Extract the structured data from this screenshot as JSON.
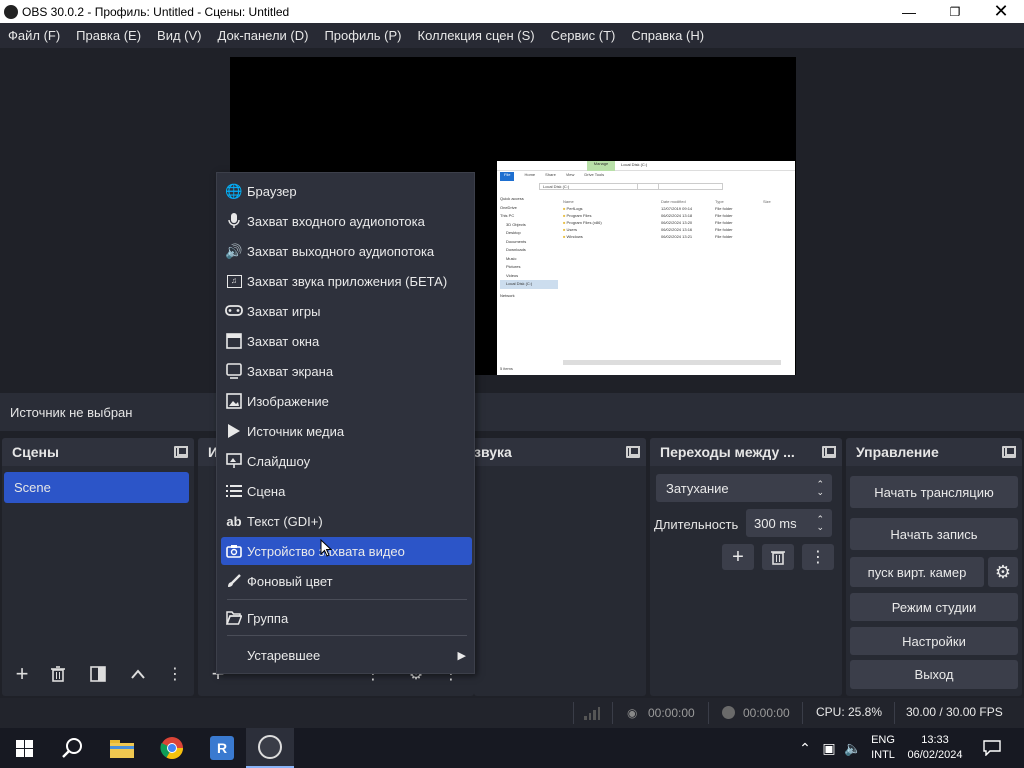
{
  "window": {
    "title": "OBS 30.0.2 - Профиль: Untitled - Сцены: Untitled",
    "controls": {
      "minimize": "minimize-icon",
      "maximize": "restore-icon",
      "close": "close-icon"
    }
  },
  "menu": [
    "Файл (F)",
    "Правка (E)",
    "Вид (V)",
    "Док-панели (D)",
    "Профиль (P)",
    "Коллекция сцен (S)",
    "Сервис (T)",
    "Справка (H)"
  ],
  "source_bar": {
    "no_source": "Источник не выбран"
  },
  "scenes_dock": {
    "title": "Сцены",
    "items": [
      "Scene"
    ],
    "selected_color": "#2c55c8"
  },
  "sources_dock": {
    "title_fragment": "И"
  },
  "audio_dock": {
    "title_fragment": "звука"
  },
  "transitions_dock": {
    "title": "Переходы между ...",
    "transition": "Затухание",
    "duration_label": "Длительность",
    "duration_value": "300 ms"
  },
  "controls_dock": {
    "title": "Управление",
    "start_stream": "Начать трансляцию",
    "start_record": "Начать запись",
    "virtual_cam": "пуск вирт. камер",
    "studio_mode": "Режим студии",
    "settings": "Настройки",
    "exit": "Выход"
  },
  "context_menu": {
    "items": [
      {
        "label": "Браузер",
        "icon": "globe-icon"
      },
      {
        "label": "Захват входного аудиопотока",
        "icon": "microphone-icon"
      },
      {
        "label": "Захват выходного аудиопотока",
        "icon": "speaker-icon"
      },
      {
        "label": "Захват звука приложения (БЕТА)",
        "icon": "app-audio-icon"
      },
      {
        "label": "Захват игры",
        "icon": "gamepad-icon"
      },
      {
        "label": "Захват окна",
        "icon": "window-icon"
      },
      {
        "label": "Захват экрана",
        "icon": "monitor-icon"
      },
      {
        "label": "Изображение",
        "icon": "image-icon"
      },
      {
        "label": "Источник медиа",
        "icon": "play-icon"
      },
      {
        "label": "Слайдшоу",
        "icon": "slideshow-icon"
      },
      {
        "label": "Сцена",
        "icon": "list-icon"
      },
      {
        "label": "Текст (GDI+)",
        "icon": "text-icon"
      },
      {
        "label": "Устройство захвата видео",
        "icon": "camera-icon",
        "selected": true
      },
      {
        "label": "Фоновый цвет",
        "icon": "brush-icon"
      }
    ],
    "group": {
      "label": "Группа",
      "icon": "folder-icon"
    },
    "deprecated": {
      "label": "Устаревшее",
      "icon": "submenu-arrow-icon"
    }
  },
  "status": {
    "stream_time": "00:00:00",
    "record_time": "00:00:00",
    "cpu": "CPU: 25.8%",
    "fps": "30.00 / 30.00 FPS"
  },
  "taskbar": {
    "lang1": "ENG",
    "lang2": "INTL",
    "time": "13:33",
    "date": "06/02/2024"
  },
  "explorer_preview": {
    "ribbon_tab": "Manage",
    "path": "Local Disk (C:)",
    "tabs": [
      "File",
      "Home",
      "Share",
      "View",
      "Drive Tools"
    ],
    "nav": [
      "Quick access",
      "OneDrive",
      "This PC",
      "3D Objects",
      "Desktop",
      "Documents",
      "Downloads",
      "Music",
      "Pictures",
      "Videos",
      "Local Disk (C:)",
      "Network"
    ],
    "columns": [
      "Name",
      "Date modified",
      "Type",
      "Size"
    ],
    "files": [
      "PerfLogs",
      "Program Files",
      "Program Files (x86)",
      "Users",
      "Windows"
    ],
    "dates": [
      "12/07/2019 09:14",
      "06/02/2024 13:18",
      "06/02/2024 13:20",
      "06/02/2024 13:16",
      "06/02/2024 13:21"
    ],
    "type": "File folder",
    "footer": "5 items"
  }
}
